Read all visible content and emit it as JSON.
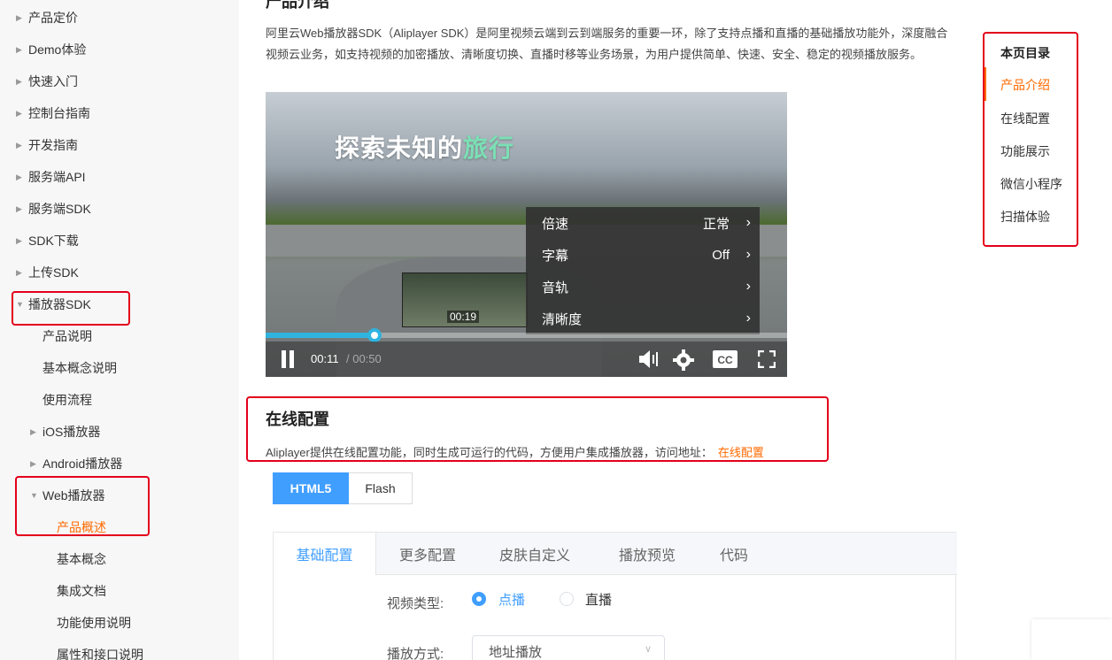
{
  "sidebar": {
    "items": [
      {
        "label": "产品定价",
        "expanded": false
      },
      {
        "label": "Demo体验",
        "expanded": false
      },
      {
        "label": "快速入门",
        "expanded": false
      },
      {
        "label": "控制台指南",
        "expanded": false
      },
      {
        "label": "开发指南",
        "expanded": false
      },
      {
        "label": "服务端API",
        "expanded": false
      },
      {
        "label": "服务端SDK",
        "expanded": false
      },
      {
        "label": "SDK下载",
        "expanded": false
      },
      {
        "label": "上传SDK",
        "expanded": false
      },
      {
        "label": "播放器SDK",
        "expanded": true
      },
      {
        "label": "产品说明"
      },
      {
        "label": "基本概念说明"
      },
      {
        "label": "使用流程"
      },
      {
        "label": "iOS播放器",
        "expanded": false
      },
      {
        "label": "Android播放器",
        "expanded": false
      },
      {
        "label": "Web播放器",
        "expanded": true
      },
      {
        "label": "产品概述",
        "active": true
      },
      {
        "label": "基本概念"
      },
      {
        "label": "集成文档"
      },
      {
        "label": "功能使用说明"
      },
      {
        "label": "属性和接口说明"
      }
    ]
  },
  "content": {
    "intro_heading": "产品介绍",
    "intro_text": "阿里云Web播放器SDK（Aliplayer SDK）是阿里视频云端到云到端服务的重要一环，除了支持点播和直播的基础播放功能外，深度融合视频云业务，如支持视频的加密播放、清晰度切换、直播时移等业务场景，为用户提供简单、快速、安全、稳定的视频播放服务。",
    "video": {
      "overlay_title_main": "探索未知的",
      "overlay_title_highlight": "旅行",
      "thumbnail_time": "00:19",
      "current_time": "00:11",
      "total_time": "/ 00:50",
      "progress": 0.208,
      "settings_menu": [
        {
          "label": "倍速",
          "value": "正常"
        },
        {
          "label": "字幕",
          "value": "Off"
        },
        {
          "label": "音轨",
          "value": ""
        },
        {
          "label": "清晰度",
          "value": ""
        }
      ],
      "icons": [
        "pause-icon",
        "volume-icon",
        "settings-icon",
        "cc-icon",
        "fullscreen-icon"
      ]
    },
    "online_config": {
      "heading": "在线配置",
      "desc": "Aliplayer提供在线配置功能，同时生成可运行的代码，方便用户集成播放器，访问地址：",
      "link": "在线配置"
    },
    "segmented": {
      "html5": "HTML5",
      "flash": "Flash",
      "selected": "HTML5"
    },
    "tabs": [
      {
        "label": "基础配置",
        "active": true
      },
      {
        "label": "更多配置"
      },
      {
        "label": "皮肤自定义"
      },
      {
        "label": "播放预览"
      },
      {
        "label": "代码"
      }
    ],
    "form": {
      "video_type_label": "视频类型:",
      "vod": "点播",
      "live": "直播",
      "selected_type": "点播",
      "play_mode_label": "播放方式:",
      "play_mode_value": "地址播放"
    }
  },
  "toc": {
    "title": "本页目录",
    "items": [
      {
        "label": "产品介绍",
        "active": true
      },
      {
        "label": "在线配置"
      },
      {
        "label": "功能展示"
      },
      {
        "label": "微信小程序"
      },
      {
        "label": "扫描体验"
      }
    ]
  },
  "colors": {
    "accent": "#ff6a00",
    "primary": "#409eff",
    "annotation": "#e3001b",
    "progress": "#2fb4e0"
  }
}
